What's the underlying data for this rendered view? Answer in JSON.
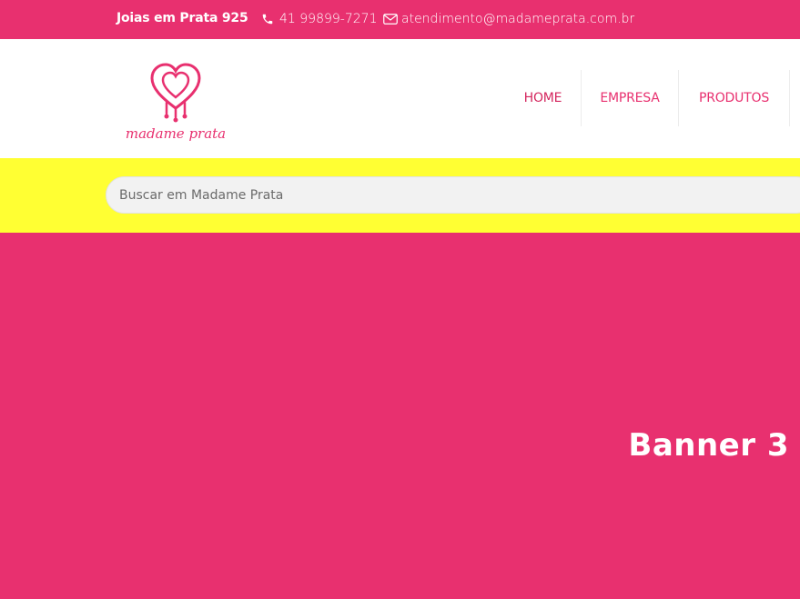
{
  "topbar": {
    "tagline": "Joias em Prata 925",
    "phone": "41 99899-7271",
    "email": "atendimento@madameprata.com.br",
    "phone_icon": "phone-icon",
    "email_icon": "envelope-icon"
  },
  "header": {
    "logo_text": "madame prata",
    "nav": {
      "home": "HOME",
      "empresa": "EMPRESA",
      "produtos": "PRODUTOS"
    }
  },
  "search": {
    "placeholder": "Buscar em Madame Prata",
    "value": ""
  },
  "banner": {
    "title": "Banner 3"
  },
  "colors": {
    "brand_pink": "#e8306f",
    "search_bar_yellow": "#ffff33",
    "white": "#ffffff"
  }
}
